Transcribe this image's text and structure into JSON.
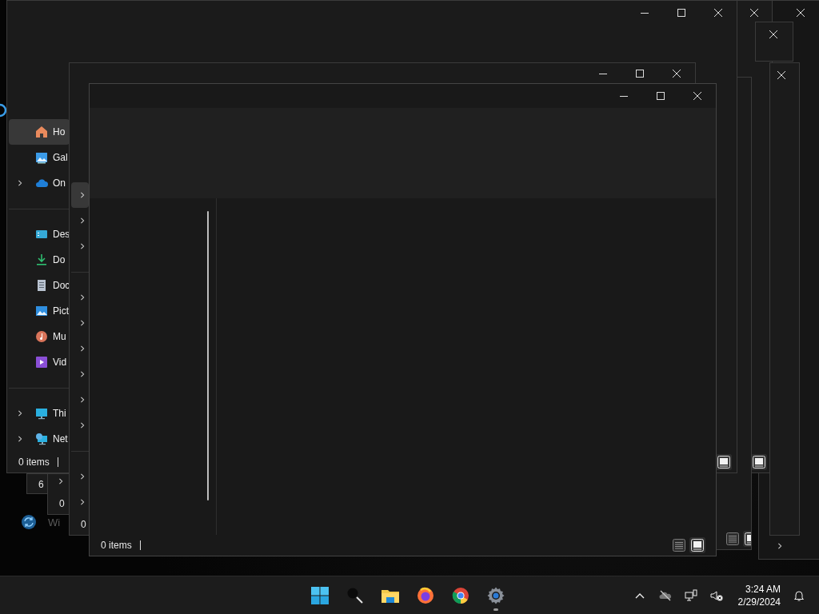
{
  "desktop_items": [
    {
      "label": "Wi"
    }
  ],
  "windows": [
    {
      "controls": [
        {
          "kind": "close"
        }
      ],
      "nav": [
        {
          "kind": "chevron",
          "expandable": true,
          "selected": false
        }
      ]
    },
    {
      "controls": [
        {
          "kind": "close"
        }
      ],
      "views": [
        {
          "kind": "tiles",
          "selected": true
        }
      ]
    },
    {
      "controls": [
        {
          "kind": "close"
        }
      ]
    },
    {
      "controls": [
        {
          "kind": "close"
        }
      ]
    },
    {
      "views": [
        {
          "kind": "details",
          "selected": false
        },
        {
          "kind": "tiles",
          "selected": true
        }
      ]
    },
    {
      "status": "6"
    },
    {
      "status": "0",
      "nav": [
        {
          "kind": "chevron",
          "expandable": true,
          "selected": false
        }
      ]
    },
    {
      "controls": [
        {
          "kind": "minimize"
        },
        {
          "kind": "maximize"
        },
        {
          "kind": "close"
        }
      ],
      "status": "0 items",
      "views": [
        {
          "kind": "tiles",
          "selected": true
        }
      ],
      "nav": [
        {
          "kind": "home",
          "label": "Ho",
          "expandable": false,
          "selected": true
        },
        {
          "kind": "gallery",
          "label": "Gal",
          "expandable": false,
          "selected": false
        },
        {
          "kind": "cloud",
          "label": "On",
          "expandable": true,
          "selected": false
        },
        {
          "kind": "separator"
        },
        {
          "kind": "desktop",
          "label": "Des",
          "expandable": false,
          "selected": false
        },
        {
          "kind": "download",
          "label": "Do",
          "expandable": false,
          "selected": false
        },
        {
          "kind": "document",
          "label": "Doc",
          "expandable": false,
          "selected": false
        },
        {
          "kind": "pictures",
          "label": "Pict",
          "expandable": false,
          "selected": false
        },
        {
          "kind": "music",
          "label": "Mu",
          "expandable": false,
          "selected": false
        },
        {
          "kind": "videos",
          "label": "Vid",
          "expandable": false,
          "selected": false
        },
        {
          "kind": "separator"
        },
        {
          "kind": "pc",
          "label": "Thi",
          "expandable": true,
          "selected": false
        },
        {
          "kind": "network",
          "label": "Net",
          "expandable": true,
          "selected": false
        }
      ]
    },
    {
      "controls": [
        {
          "kind": "minimize"
        },
        {
          "kind": "maximize"
        },
        {
          "kind": "close"
        }
      ],
      "status": "0",
      "nav": [
        {
          "kind": "chevron",
          "expandable": true,
          "selected": true
        },
        {
          "kind": "chevron",
          "expandable": true,
          "selected": false
        },
        {
          "kind": "chevron",
          "expandable": true,
          "selected": false
        },
        {
          "kind": "separator"
        },
        {
          "kind": "chevron",
          "expandable": true,
          "selected": false
        },
        {
          "kind": "chevron",
          "expandable": true,
          "selected": false
        },
        {
          "kind": "chevron",
          "expandable": true,
          "selected": false
        },
        {
          "kind": "chevron",
          "expandable": true,
          "selected": false
        },
        {
          "kind": "chevron",
          "expandable": true,
          "selected": false
        },
        {
          "kind": "chevron",
          "expandable": true,
          "selected": false
        },
        {
          "kind": "separator"
        },
        {
          "kind": "chevron",
          "expandable": true,
          "selected": false
        },
        {
          "kind": "chevron",
          "expandable": true,
          "selected": false
        }
      ]
    },
    {
      "controls": [
        {
          "kind": "minimize"
        },
        {
          "kind": "maximize"
        },
        {
          "kind": "close"
        }
      ],
      "header": true,
      "status": "0 items",
      "views": [
        {
          "kind": "details",
          "selected": false
        },
        {
          "kind": "tiles",
          "selected": true
        }
      ]
    }
  ],
  "taskbar": {
    "apps": [
      {
        "kind": "start",
        "running": false
      },
      {
        "kind": "search",
        "running": false
      },
      {
        "kind": "files",
        "running": false
      },
      {
        "kind": "firefox",
        "running": false
      },
      {
        "kind": "chrome",
        "running": false
      },
      {
        "kind": "settings",
        "running": true
      }
    ],
    "tray": [
      {
        "kind": "chevron"
      },
      {
        "kind": "cloud-off"
      },
      {
        "kind": "network"
      },
      {
        "kind": "volume-muted"
      }
    ],
    "clock": {
      "time": "3:24 AM",
      "date": "2/29/2024"
    }
  }
}
